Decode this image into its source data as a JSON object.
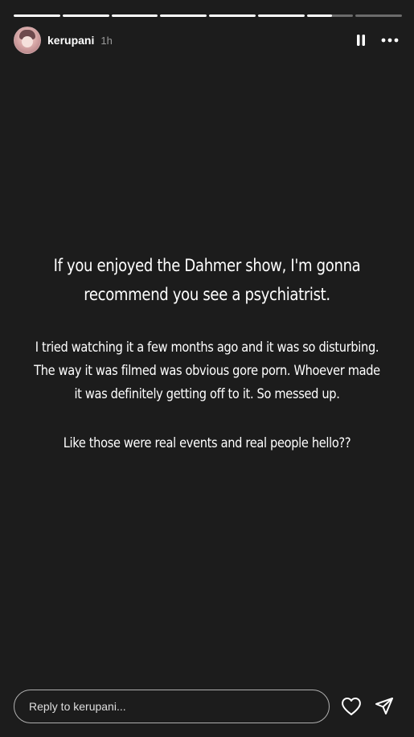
{
  "story": {
    "segment_count": 8,
    "segments_progress": [
      1,
      1,
      1,
      1,
      1,
      1,
      0.55,
      0
    ]
  },
  "header": {
    "username": "kerupani",
    "time": "1h",
    "pause_icon": "pause-icon",
    "more_icon": "more-horizontal-icon"
  },
  "content": {
    "headline_line1": "If you enjoyed the Dahmer show, I'm gonna",
    "headline_line2": "recommend you see a psychiatrist.",
    "para1_line1": "I tried watching it a few months ago and it was so disturbing.",
    "para1_line2": "The way it was filmed was obvious gore porn. Whoever made",
    "para1_line3": "it was definitely getting off to it. So messed up.",
    "para2_line1": "Like those were real events and real people hello??"
  },
  "footer": {
    "reply_placeholder": "Reply to kerupani...",
    "like_icon": "heart-icon",
    "share_icon": "send-icon"
  },
  "colors": {
    "background": "#1c1c1c",
    "text": "#ffffff"
  }
}
